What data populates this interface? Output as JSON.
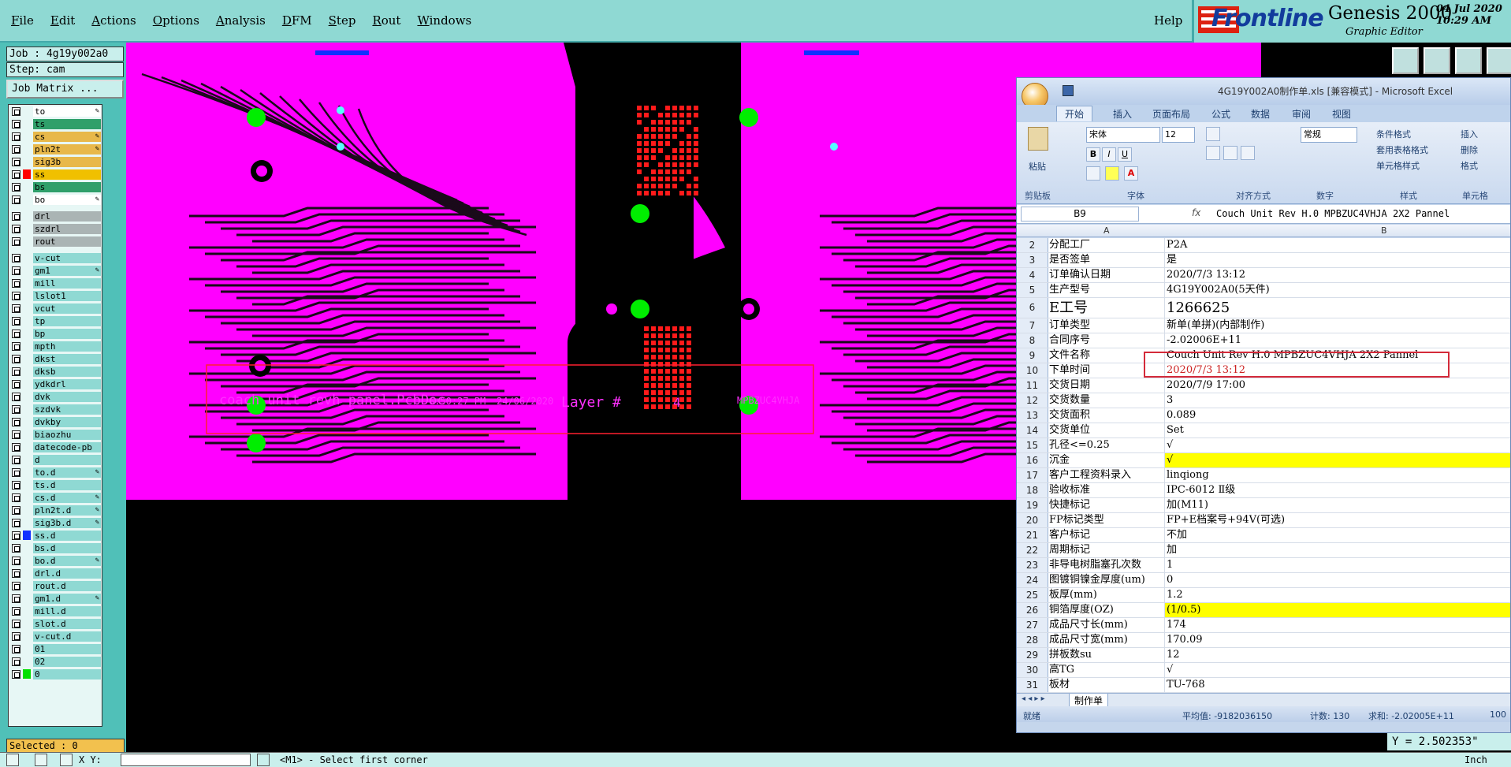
{
  "menu": [
    "File",
    "Edit",
    "Actions",
    "Options",
    "Analysis",
    "DFM",
    "Step",
    "Rout",
    "Windows"
  ],
  "help_label": "Help",
  "brand": {
    "logo_text": "Frontline",
    "product": "Genesis 2000",
    "subtitle": "Graphic Editor",
    "date": "04 Jul 2020",
    "time": "10:29 AM"
  },
  "job_label": "Job : 4g19y002a0",
  "step_label": "Step: cam",
  "job_matrix_label": "Job Matrix ...",
  "selected_label": "Selected : 0",
  "layers": [
    {
      "name": "to",
      "bg": "#ffffff",
      "edit": true,
      "sw": ""
    },
    {
      "name": "ts",
      "bg": "#2f9f6a",
      "edit": false,
      "sw": ""
    },
    {
      "name": "cs",
      "bg": "#e8b84a",
      "edit": true,
      "sw": ""
    },
    {
      "name": "pln2t",
      "bg": "#e8b84a",
      "edit": true,
      "sw": ""
    },
    {
      "name": "sig3b",
      "bg": "#e8b84a",
      "edit": false,
      "sw": ""
    },
    {
      "name": "ss",
      "bg": "#f0c000",
      "edit": false,
      "sw": "#ff0000",
      "dot": true
    },
    {
      "name": "bs",
      "bg": "#2f9f6a",
      "edit": false,
      "sw": ""
    },
    {
      "name": "bo",
      "bg": "#ffffff",
      "edit": true,
      "sw": ""
    },
    {
      "name": "drl",
      "bg": "#aab4b4",
      "edit": false,
      "sw": "",
      "gap": true
    },
    {
      "name": "szdrl",
      "bg": "#aab4b4",
      "edit": false,
      "sw": ""
    },
    {
      "name": "rout",
      "bg": "#aab4b4",
      "edit": false,
      "sw": ""
    },
    {
      "name": "v-cut",
      "bg": "#8fd9d3",
      "edit": false,
      "sw": "",
      "gap": true
    },
    {
      "name": "gm1",
      "bg": "#8fd9d3",
      "edit": true,
      "sw": ""
    },
    {
      "name": "mill",
      "bg": "#8fd9d3",
      "edit": false,
      "sw": ""
    },
    {
      "name": "lslot1",
      "bg": "#8fd9d3",
      "edit": false,
      "sw": ""
    },
    {
      "name": "vcut",
      "bg": "#8fd9d3",
      "edit": false,
      "sw": ""
    },
    {
      "name": "tp",
      "bg": "#8fd9d3",
      "edit": false,
      "sw": ""
    },
    {
      "name": "bp",
      "bg": "#8fd9d3",
      "edit": false,
      "sw": ""
    },
    {
      "name": "mpth",
      "bg": "#8fd9d3",
      "edit": false,
      "sw": ""
    },
    {
      "name": "dkst",
      "bg": "#8fd9d3",
      "edit": false,
      "sw": ""
    },
    {
      "name": "dksb",
      "bg": "#8fd9d3",
      "edit": false,
      "sw": ""
    },
    {
      "name": "ydkdrl",
      "bg": "#8fd9d3",
      "edit": false,
      "sw": ""
    },
    {
      "name": "dvk",
      "bg": "#8fd9d3",
      "edit": false,
      "sw": ""
    },
    {
      "name": "szdvk",
      "bg": "#8fd9d3",
      "edit": false,
      "sw": ""
    },
    {
      "name": "dvkby",
      "bg": "#8fd9d3",
      "edit": false,
      "sw": ""
    },
    {
      "name": "biaozhu",
      "bg": "#8fd9d3",
      "edit": false,
      "sw": ""
    },
    {
      "name": "datecode-pb",
      "bg": "#8fd9d3",
      "edit": false,
      "sw": ""
    },
    {
      "name": "d",
      "bg": "#8fd9d3",
      "edit": false,
      "sw": ""
    },
    {
      "name": "to.d",
      "bg": "#8fd9d3",
      "edit": true,
      "sw": ""
    },
    {
      "name": "ts.d",
      "bg": "#8fd9d3",
      "edit": false,
      "sw": ""
    },
    {
      "name": "cs.d",
      "bg": "#8fd9d3",
      "edit": true,
      "sw": ""
    },
    {
      "name": "pln2t.d",
      "bg": "#8fd9d3",
      "edit": true,
      "sw": ""
    },
    {
      "name": "sig3b.d",
      "bg": "#8fd9d3",
      "edit": true,
      "sw": ""
    },
    {
      "name": "ss.d",
      "bg": "#8fd9d3",
      "edit": false,
      "sw": "#1030ff"
    },
    {
      "name": "bs.d",
      "bg": "#8fd9d3",
      "edit": false,
      "sw": ""
    },
    {
      "name": "bo.d",
      "bg": "#8fd9d3",
      "edit": true,
      "sw": ""
    },
    {
      "name": "drl.d",
      "bg": "#8fd9d3",
      "edit": false,
      "sw": ""
    },
    {
      "name": "rout.d",
      "bg": "#8fd9d3",
      "edit": false,
      "sw": ""
    },
    {
      "name": "gm1.d",
      "bg": "#8fd9d3",
      "edit": true,
      "sw": ""
    },
    {
      "name": "mill.d",
      "bg": "#8fd9d3",
      "edit": false,
      "sw": ""
    },
    {
      "name": "slot.d",
      "bg": "#8fd9d3",
      "edit": false,
      "sw": ""
    },
    {
      "name": "v-cut.d",
      "bg": "#8fd9d3",
      "edit": false,
      "sw": ""
    },
    {
      "name": "01",
      "bg": "#8fd9d3",
      "edit": false,
      "sw": ""
    },
    {
      "name": "02",
      "bg": "#8fd9d3",
      "edit": false,
      "sw": ""
    },
    {
      "name": "0",
      "bg": "#8fd9d3",
      "edit": false,
      "sw": "#00e000"
    }
  ],
  "canvas_text": {
    "doc": "coach unit revh panel.PcbDoc",
    "time": "6:50:27 PM",
    "date": "24/06/2020",
    "layer": "Layer #",
    "layer_num": "4",
    "code": "MPBZUC4VHJA"
  },
  "bottom": {
    "xy": "X Y:",
    "message": "<M1> - Select first corner",
    "unit": "Inch"
  },
  "y_readout": "Y = 2.502353\"",
  "excel": {
    "title": "4G19Y002A0制作单.xls [兼容模式] - Microsoft Excel",
    "tabs": [
      "开始",
      "插入",
      "页面布局",
      "公式",
      "数据",
      "审阅",
      "视图"
    ],
    "ribbon": {
      "paste": "粘贴",
      "font": "宋体",
      "size": "12",
      "numfmt": "常规",
      "cond": "条件格式",
      "tablefmt": "套用表格格式",
      "cellstyle": "单元格样式",
      "insert": "插入",
      "delete": "删除",
      "format": "格式",
      "groups": [
        "剪贴板",
        "字体",
        "对齐方式",
        "数字",
        "样式",
        "单元格"
      ]
    },
    "cellref": "B9",
    "fx": "fx",
    "formula": "Couch Unit Rev H.0 MPBZUC4VHJA 2X2 Pannel",
    "col_a": "A",
    "col_b": "B",
    "rows": [
      [
        "2",
        "分配工厂",
        "P2A"
      ],
      [
        "3",
        "是否签单",
        "是"
      ],
      [
        "4",
        "订单确认日期",
        "2020/7/3 13:12"
      ],
      [
        "5",
        "生产型号",
        "4G19Y002A0(5天件)"
      ],
      [
        "6",
        "E工号",
        "1266625"
      ],
      [
        "7",
        "订单类型",
        "新单(单拼)(内部制作)"
      ],
      [
        "8",
        "合同序号",
        "-2.02006E+11"
      ],
      [
        "9",
        "文件名称",
        "Couch Unit Rev H.0 MPBZUC4VHJA 2X2 Pannel"
      ],
      [
        "10",
        "下单时间",
        "2020/7/3 13:12"
      ],
      [
        "11",
        "交货日期",
        "2020/7/9 17:00"
      ],
      [
        "12",
        "交货数量",
        "3"
      ],
      [
        "13",
        "交货面积",
        "0.089"
      ],
      [
        "14",
        "交货单位",
        "Set"
      ],
      [
        "15",
        "孔径<=0.25",
        "√"
      ],
      [
        "16",
        "沉金",
        "√"
      ],
      [
        "17",
        "客户工程资料录入",
        "linqiong"
      ],
      [
        "18",
        "验收标准",
        "IPC-6012 Ⅱ级"
      ],
      [
        "19",
        "快捷标记",
        "加(M11)"
      ],
      [
        "20",
        "FP标记类型",
        "FP+E档案号+94V(可选)"
      ],
      [
        "21",
        "客户标记",
        "不加"
      ],
      [
        "22",
        "周期标记",
        "加"
      ],
      [
        "23",
        "非导电树脂塞孔次数",
        "1"
      ],
      [
        "24",
        "图镀铜镍金厚度(um)",
        "0"
      ],
      [
        "25",
        "板厚(mm)",
        "1.2"
      ],
      [
        "26",
        "铜箔厚度(OZ)",
        "(1/0.5)"
      ],
      [
        "27",
        "成品尺寸长(mm)",
        "174"
      ],
      [
        "28",
        "成品尺寸宽(mm)",
        "170.09"
      ],
      [
        "29",
        "拼板数su",
        "12"
      ],
      [
        "30",
        "高TG",
        "√"
      ],
      [
        "31",
        "板材",
        "TU-768"
      ]
    ],
    "sheet_tab": "制作单",
    "status": {
      "ready": "就绪",
      "avg": "平均值: -9182036150",
      "count": "计数: 130",
      "sum": "求和: -2.02005E+11",
      "zoom": "100"
    }
  },
  "colors": {
    "board": "#ff00ff",
    "trace": "#1a0a1a",
    "pad": "#00ee00",
    "grid": "#ff1a1a",
    "frame": "#ff2030"
  }
}
